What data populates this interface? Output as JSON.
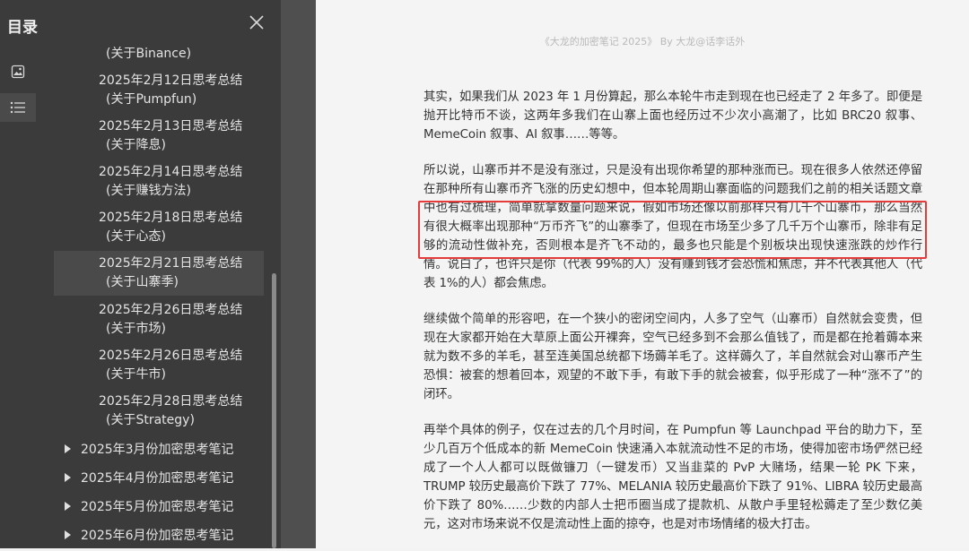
{
  "sidebar": {
    "title": "目录",
    "toc_items": [
      {
        "line1": "(关于Binance)",
        "line2": ""
      },
      {
        "line1": "2025年2月12日思考总结",
        "line2": "(关于Pumpfun)"
      },
      {
        "line1": "2025年2月13日思考总结",
        "line2": "(关于降息)"
      },
      {
        "line1": "2025年2月14日思考总结",
        "line2": "(关于赚钱方法)"
      },
      {
        "line1": "2025年2月18日思考总结",
        "line2": "(关于心态)"
      },
      {
        "line1": "2025年2月21日思考总结",
        "line2": "(关于山寨季)"
      },
      {
        "line1": "2025年2月26日思考总结",
        "line2": "(关于市场)"
      },
      {
        "line1": "2025年2月26日思考总结",
        "line2": "(关于牛市)"
      },
      {
        "line1": "2025年2月28日思考总结",
        "line2": "(关于Strategy)"
      }
    ],
    "groups": [
      "2025年3月份加密思考笔记",
      "2025年4月份加密思考笔记",
      "2025年5月份加密思考笔记",
      "2025年6月份加密思考笔记"
    ]
  },
  "page": {
    "header": "《大龙的加密笔记 2025》 By 大龙@话李话外",
    "paragraphs": [
      "其实，如果我们从 2023 年 1 月份算起，那么本轮牛市走到现在也已经走了 2 年多了。即便是抛开比特币不谈，这两年多我们在山寨上面也经历过不少次小高潮了，比如 BRC20 叙事、MemeCoin 叙事、AI 叙事……等等。",
      "所以说，山寨币并不是没有涨过，只是没有出现你希望的那种涨而已。现在很多人依然还停留在那种所有山寨币齐飞涨的历史幻想中，但本轮周期山寨面临的问题我们之前的相关话题文章中也有过梳理，简单就拿数量问题来说，假如市场还像以前那样只有几千个山寨币，那么当然有很大概率出现那种“万币齐飞”的山寨季了，但现在市场至少多了几千万个山寨币，除非有足够的流动性做补充，否则根本是齐飞不动的，最多也只能是个别板块出现快速涨跌的炒作行情。说白了，也许只是你（代表 99%的人）没有赚到钱才会恐慌和焦虑，并不代表其他人（代表 1%的人）都会焦虑。",
      "继续做个简单的形容吧，在一个狭小的密闭空间内，人多了空气（山寨币）自然就会变贵，但现在大家都开始在大草原上面公开裸奔，空气已经多到不会那么值钱了，而是都在抢着薅本来就为数不多的羊毛，甚至连美国总统都下场薅羊毛了。这样薅久了，羊自然就会对山寨币产生恐惧：被套的想着回本，观望的不敢下手，有敢下手的就会被套，似乎形成了一种“涨不了”的闭环。",
      "再举个具体的例子，仅在过去的几个月时间，在 Pumpfun 等 Launchpad 平台的助力下，至少几百万个低成本的新 MemeCoin 快速涌入本就流动性不足的市场，使得加密市场俨然已经成了一个人人都可以既做镰刀（一键发币）又当韭菜的 PvP 大赌场，结果一轮 PK 下来，TRUMP 较历史最高价下跌了 77%、MELANIA 较历史最高价下跌了 91%、LIBRA 较历史最高价下跌了 80%……少数的内部人士把币圈当成了提款机、从散户手里轻松薅走了至少数亿美元，这对市场来说不仅是流动性上面的掠夺，也是对市场情绪的极大打击。"
    ]
  }
}
